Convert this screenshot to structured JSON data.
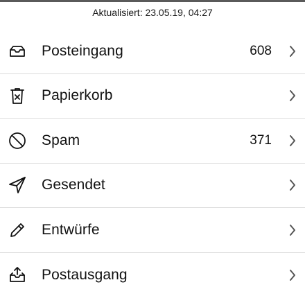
{
  "status": {
    "updated": "Aktualisiert: 23.05.19, 04:27"
  },
  "folders": [
    {
      "label": "Posteingang",
      "count": "608",
      "icon": "inbox-icon"
    },
    {
      "label": "Papierkorb",
      "count": "",
      "icon": "trash-icon"
    },
    {
      "label": "Spam",
      "count": "371",
      "icon": "spam-icon"
    },
    {
      "label": "Gesendet",
      "count": "",
      "icon": "send-icon"
    },
    {
      "label": "Entwürfe",
      "count": "",
      "icon": "pencil-icon"
    },
    {
      "label": "Postausgang",
      "count": "",
      "icon": "outbox-icon"
    }
  ]
}
